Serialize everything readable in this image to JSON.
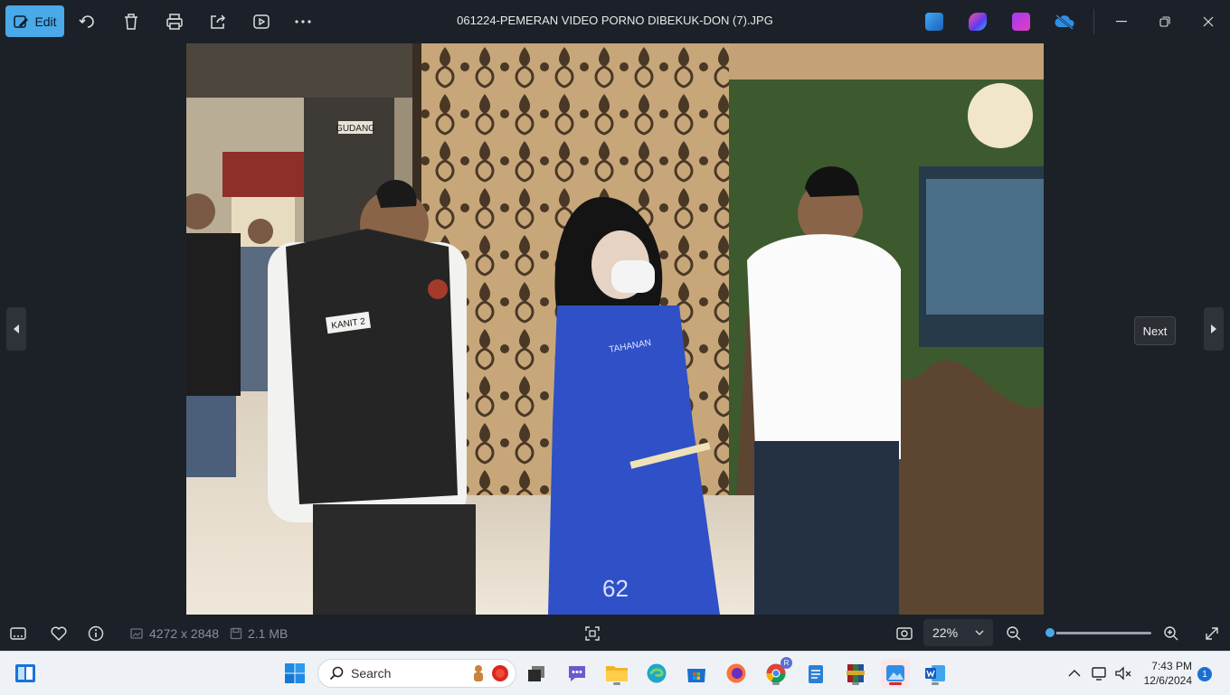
{
  "toolbar": {
    "edit_label": "Edit",
    "filename": "061224-PEMERAN VIDEO PORNO DIBEKUK-DON (7).JPG"
  },
  "viewer": {
    "next_tooltip": "Next"
  },
  "photo": {
    "labels": {
      "gudang_sign": "GUDANG",
      "vest_patch": "KANIT 2",
      "shirt_text": "TAHANAN",
      "shirt_number": "62"
    }
  },
  "status_bar": {
    "dimensions": "4272 x 2848",
    "file_size": "2.1 MB",
    "zoom": "22%",
    "zoom_level": 0.05
  },
  "taskbar": {
    "search_placeholder": "Search",
    "time": "7:43 PM",
    "date": "12/6/2024",
    "notification_count": "1"
  },
  "colors": {
    "accent": "#4aa9e8",
    "app_background": "#1c2129",
    "taskbar_background": "#eef2f7"
  }
}
